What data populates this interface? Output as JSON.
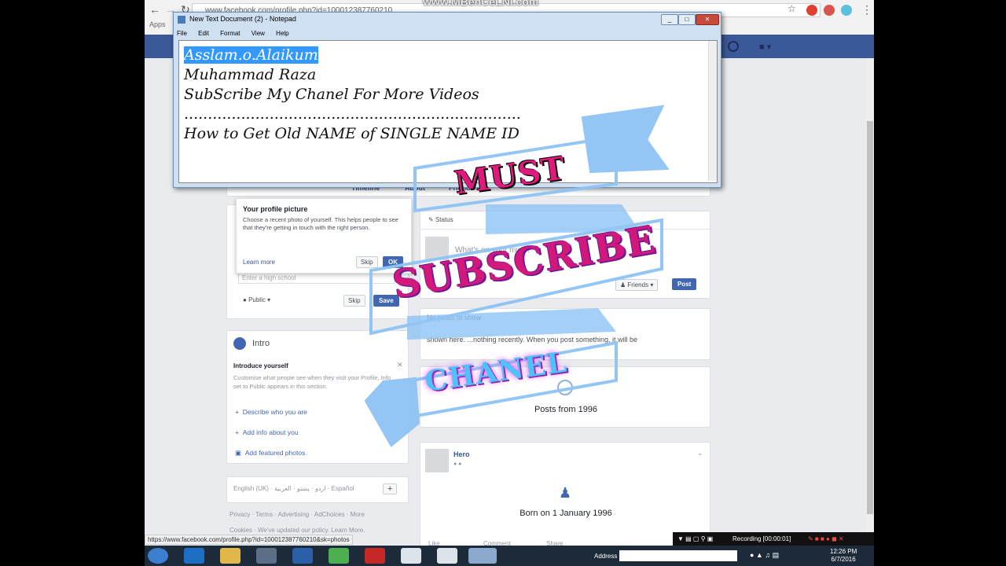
{
  "browser": {
    "url": "www.facebook.com/profile.php?id=100012387760210",
    "bookmarks_label": "Apps",
    "status_url": "https://www.facebook.com/profile.php?id=100012387760210&sk=photos"
  },
  "watermark_top": "www.MBenCeLNI.com",
  "notepad": {
    "title": "New Text Document (2) - Notepad",
    "menu": [
      "File",
      "Edit",
      "Format",
      "View",
      "Help"
    ],
    "lines": [
      "Asslam.o.Alaikum",
      "Muhammad Raza",
      "SubScribe My Chanel For More Videos",
      ".......................................................................",
      "How to Get Old NAME of SINGLE NAME ID"
    ]
  },
  "profile_tabs": [
    "Timeline",
    "About",
    "Friends"
  ],
  "profile_popup": {
    "title": "Your profile picture",
    "body": "Choose a recent photo of yourself. This helps people to see that they're getting in touch with the right person.",
    "learn_more": "Learn more",
    "skip": "Skip",
    "ok": "OK"
  },
  "school_edit": {
    "placeholder": "Enter a high school",
    "privacy": "Public",
    "skip": "Skip",
    "save": "Save"
  },
  "intro": {
    "heading": "Intro",
    "introduce_title": "Introduce yourself",
    "introduce_body": "Customise what people see when they visit your Profile. Info set to Public appears in this section.",
    "links": [
      "Describe who you are",
      "Add info about you",
      "Add featured photos"
    ]
  },
  "languages": "English (UK) · اردو · پښتو · العربية · Español",
  "footer_links": "Privacy · Terms · Advertising · AdChoices · More",
  "footer_cookies": "Cookies · We've updated our policy. Learn More.",
  "composer": {
    "status_tab": "Status",
    "placeholder": "What's on your mind?",
    "audience": "Friends",
    "post": "Post"
  },
  "no_posts": {
    "title": "No posts to show",
    "body": "shown here. ...nothing recently. When you post something, it will be"
  },
  "posts_from": "Posts from 1996",
  "life_event": {
    "name": "Hero",
    "born": "Born on 1 January 1996",
    "actions": [
      "Like",
      "Comment",
      "Share"
    ]
  },
  "overlay": {
    "must": "MUST",
    "subscribe": "SUBSCRIBE",
    "chanel": "CHANEL",
    "ribbon_color": "#8fc4f5",
    "must_color": "#e0197d",
    "subscribe_color": "#d4177a",
    "chanel_color": "#4fc3f7"
  },
  "recorder": {
    "label": "Recording [00:00:01]"
  },
  "taskbar": {
    "address_label": "Address",
    "time": "12:26 PM",
    "date": "6/7/2016"
  }
}
